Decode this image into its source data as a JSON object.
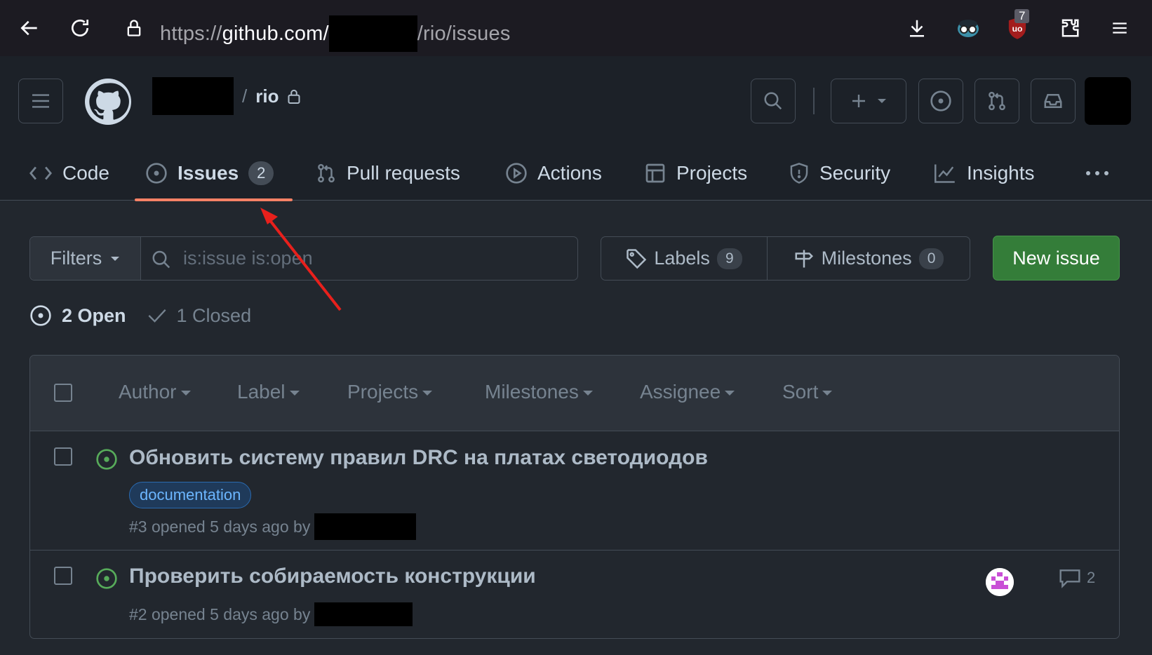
{
  "browser": {
    "url_prefix": "https://",
    "url_domain": "github.com/",
    "url_suffix": "/rio/issues",
    "ublock_count": "7",
    "icons": [
      "back-icon",
      "reload-icon",
      "lock-icon",
      "download-icon",
      "privacy-badger-icon",
      "ublock-icon",
      "extensions-icon",
      "menu-icon"
    ]
  },
  "header": {
    "repo_separator": "/",
    "repo_name": "rio"
  },
  "tabs": [
    {
      "label": "Code",
      "icon": "code-icon"
    },
    {
      "label": "Issues",
      "icon": "issue-opened-icon",
      "count": "2",
      "active": true
    },
    {
      "label": "Pull requests",
      "icon": "pull-request-icon"
    },
    {
      "label": "Actions",
      "icon": "play-icon"
    },
    {
      "label": "Projects",
      "icon": "table-icon"
    },
    {
      "label": "Security",
      "icon": "shield-icon"
    },
    {
      "label": "Insights",
      "icon": "graph-icon"
    }
  ],
  "toolbar": {
    "filters_label": "Filters",
    "search_value": "is:issue is:open",
    "labels_label": "Labels",
    "labels_count": "9",
    "milestones_label": "Milestones",
    "milestones_count": "0",
    "new_issue_label": "New issue"
  },
  "states": {
    "open_label": "2 Open",
    "closed_label": "1 Closed"
  },
  "list_header": {
    "filters": [
      "Author",
      "Label",
      "Projects",
      "Milestones",
      "Assignee",
      "Sort"
    ]
  },
  "issues": [
    {
      "title": "Обновить систему правил DRC на платах светодиодов",
      "label": "documentation",
      "meta": "#3 opened 5 days ago by"
    },
    {
      "title": "Проверить собираемость конструкции",
      "meta": "#2 opened 5 days ago by",
      "comments": "2"
    }
  ],
  "colors": {
    "accent_underline": "#f78166",
    "open_green": "#57ab5a",
    "new_issue_green": "#347d39",
    "label_blue": "#6cb6ff",
    "annotation_arrow": "#e8201c"
  }
}
